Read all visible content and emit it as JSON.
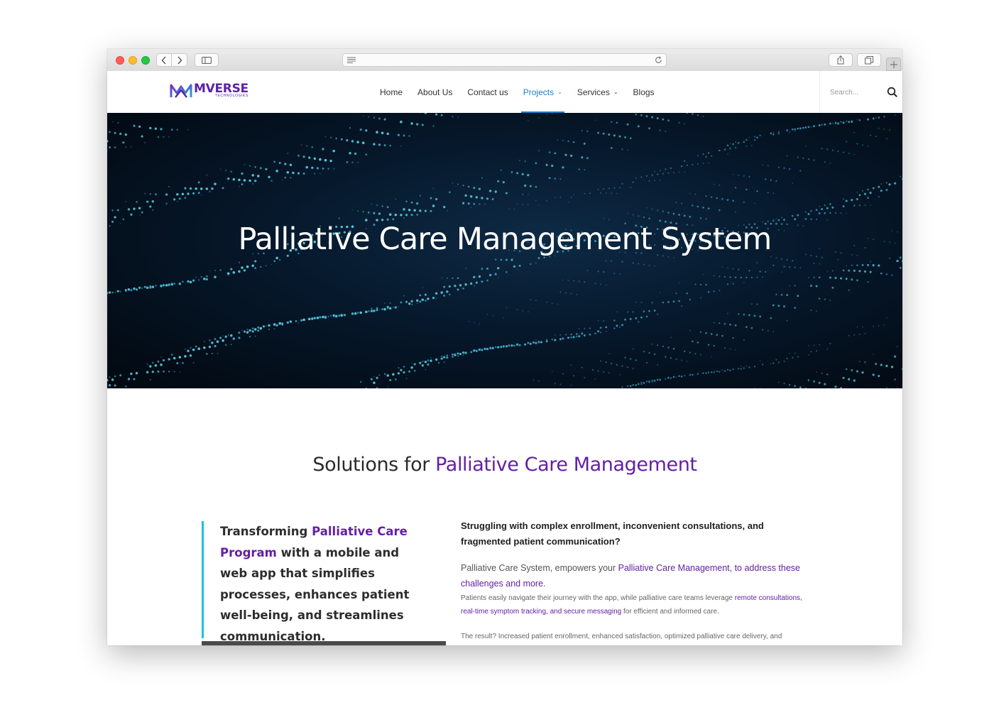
{
  "browser": {
    "traffic_lights": [
      "close",
      "minimize",
      "zoom"
    ]
  },
  "site": {
    "logo": {
      "name": "MVERSE",
      "tagline": "TECHNOLOGIES",
      "color": "#5b21a8"
    },
    "nav": [
      {
        "label": "Home",
        "has_dropdown": false,
        "active": false
      },
      {
        "label": "About Us",
        "has_dropdown": false,
        "active": false
      },
      {
        "label": "Contact us",
        "has_dropdown": false,
        "active": false
      },
      {
        "label": "Projects",
        "has_dropdown": true,
        "active": true
      },
      {
        "label": "Services",
        "has_dropdown": true,
        "active": false
      },
      {
        "label": "Blogs",
        "has_dropdown": false,
        "active": false
      }
    ],
    "search": {
      "placeholder": "Search..."
    },
    "accent_color": "#1f7ec8"
  },
  "hero": {
    "title": "Palliative Care Management System"
  },
  "section": {
    "title_plain": "Solutions for ",
    "title_highlight": "Palliative Care Management"
  },
  "quote": {
    "p1": "Transforming ",
    "highlight": "Palliative Care Program",
    "p2": " with a mobile and web app that simplifies processes, enhances patient well-being, and streamlines communication.",
    "border_color": "#1cc3dc"
  },
  "content": {
    "lead": "Struggling with complex enrollment, inconvenient consultations, and fragmented patient communication?",
    "body1_plain": "Palliative Care System, empowers your ",
    "body1_highlight": "Palliative Care Management, to address these challenges and more.",
    "body2_plain": "Patients easily navigate their journey with the app, while palliative care teams leverage ",
    "body2_highlight": "remote consultations, real-time symptom tracking, and secure messaging",
    "body2_end": " for efficient and informed care.",
    "body3": "The result? Increased patient enrollment, enhanced satisfaction, optimized palliative care delivery, and",
    "highlight_color": "#6221a3"
  }
}
